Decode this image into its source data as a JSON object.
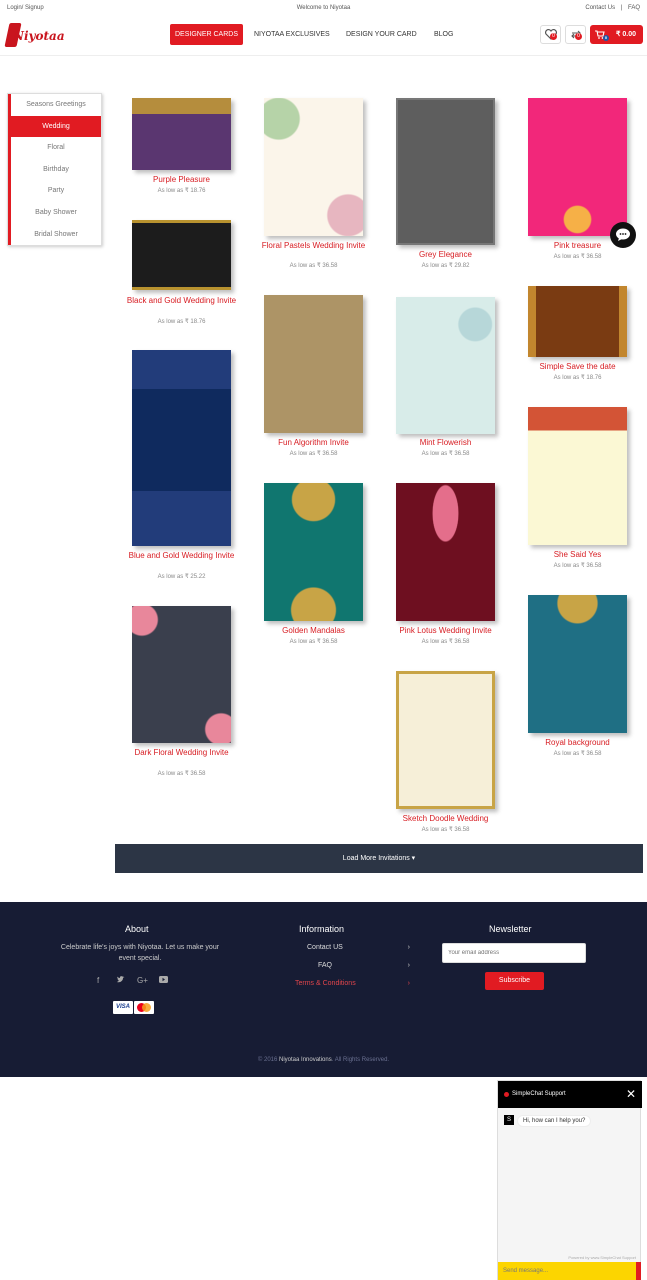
{
  "topbar": {
    "login": "Login/ Signup",
    "welcome": "Welcome to Niyotaa",
    "contact": "Contact Us",
    "sep": "|",
    "faq": "FAQ"
  },
  "brand": {
    "name": "Niyotaa",
    "color": "#c9151e"
  },
  "nav": {
    "items": [
      "DESIGNER CARDS",
      "NIYOTAA EXCLUSIVES",
      "DESIGN YOUR CARD",
      "BLOG"
    ]
  },
  "header_icons": {
    "wishlist_count": "0",
    "compare_count": "0",
    "cart_count": "0",
    "cart_amount": "₹ 0.00"
  },
  "sidebar": {
    "items": [
      "Seasons Greetings",
      "Wedding",
      "Floral",
      "Birthday",
      "Party",
      "Baby Shower",
      "Bridal Shower"
    ],
    "active": "Wedding"
  },
  "cards": [
    {
      "title": "Purple Pleasure",
      "price": "As low as ₹ 18.76"
    },
    {
      "title": "Black and Gold Wedding Invite",
      "price": "As low as ₹ 18.76"
    },
    {
      "title": "Blue and Gold Wedding Invite",
      "price": "As low as ₹ 25.22"
    },
    {
      "title": "Dark Floral Wedding Invite",
      "price": "As low as ₹ 36.58"
    },
    {
      "title": "Floral Pastels Wedding Invite",
      "price": "As low as ₹ 36.58"
    },
    {
      "title": "Fun Algorithm Invite",
      "price": "As low as ₹ 36.58"
    },
    {
      "title": "Golden Mandalas",
      "price": "As low as ₹ 36.58"
    },
    {
      "title": "Grey Elegance",
      "price": "As low as ₹ 29.82"
    },
    {
      "title": "Mint Flowerish",
      "price": "As low as ₹ 36.58"
    },
    {
      "title": "Pink Lotus Wedding Invite",
      "price": "As low as ₹ 36.58"
    },
    {
      "title": "Sketch Doodle Wedding",
      "price": "As low as ₹ 36.58"
    },
    {
      "title": "Pink treasure",
      "price": "As low as ₹ 36.58"
    },
    {
      "title": "Simple Save the date",
      "price": "As low as ₹ 18.76"
    },
    {
      "title": "She Said Yes",
      "price": "As low as ₹ 36.58"
    },
    {
      "title": "Royal background",
      "price": "As low as ₹ 36.58"
    }
  ],
  "load_more": "Load More Invitations ▾",
  "footer": {
    "about_title": "About",
    "about_text": "Celebrate life's joys with Niyotaa. Let us make your event special.",
    "info_title": "Information",
    "links": [
      "Contact US",
      "FAQ",
      "Terms & Conditions"
    ],
    "newsletter_title": "Newsletter",
    "email_placeholder": "Your email address",
    "subscribe": "Subscribe",
    "copyright_pre": "© 2016",
    "copyright_brand": "Niyotaa Innovations",
    "copyright_post": ". All Rights Reserved."
  },
  "chat": {
    "title": "SimpleChat Support",
    "close": "✕",
    "avatar": "S",
    "greeting": "Hi, how can I help you?",
    "powered": "Powered by www.SimpleChat Support",
    "send_placeholder": "Send message..."
  }
}
